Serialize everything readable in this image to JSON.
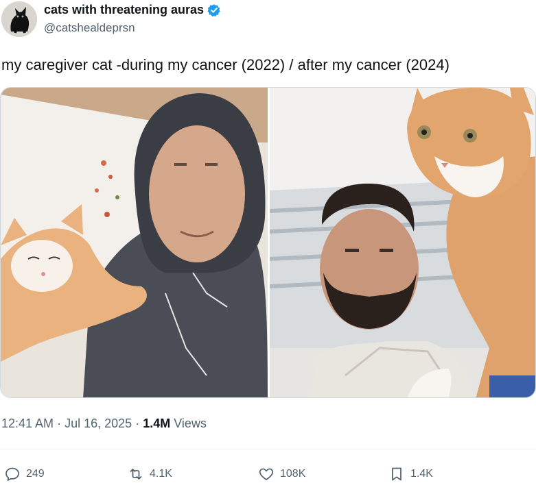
{
  "author": {
    "name": "cats with threatening auras",
    "handle": "@catshealdeprsn",
    "verified": true,
    "verified_color": "#1d9bf0"
  },
  "tweet": {
    "text": "my caregiver cat -during my cancer (2022) / after my cancer (2024)"
  },
  "media": [
    {
      "icon": "photo-during-cancer"
    },
    {
      "icon": "photo-after-cancer"
    }
  ],
  "meta": {
    "time": "12:41 AM",
    "separator": "·",
    "date": "Jul 16, 2025",
    "views_count": "1.4M",
    "views_label": "Views"
  },
  "actions": {
    "replies": "249",
    "reposts": "4.1K",
    "likes": "108K",
    "bookmarks": "1.4K"
  }
}
